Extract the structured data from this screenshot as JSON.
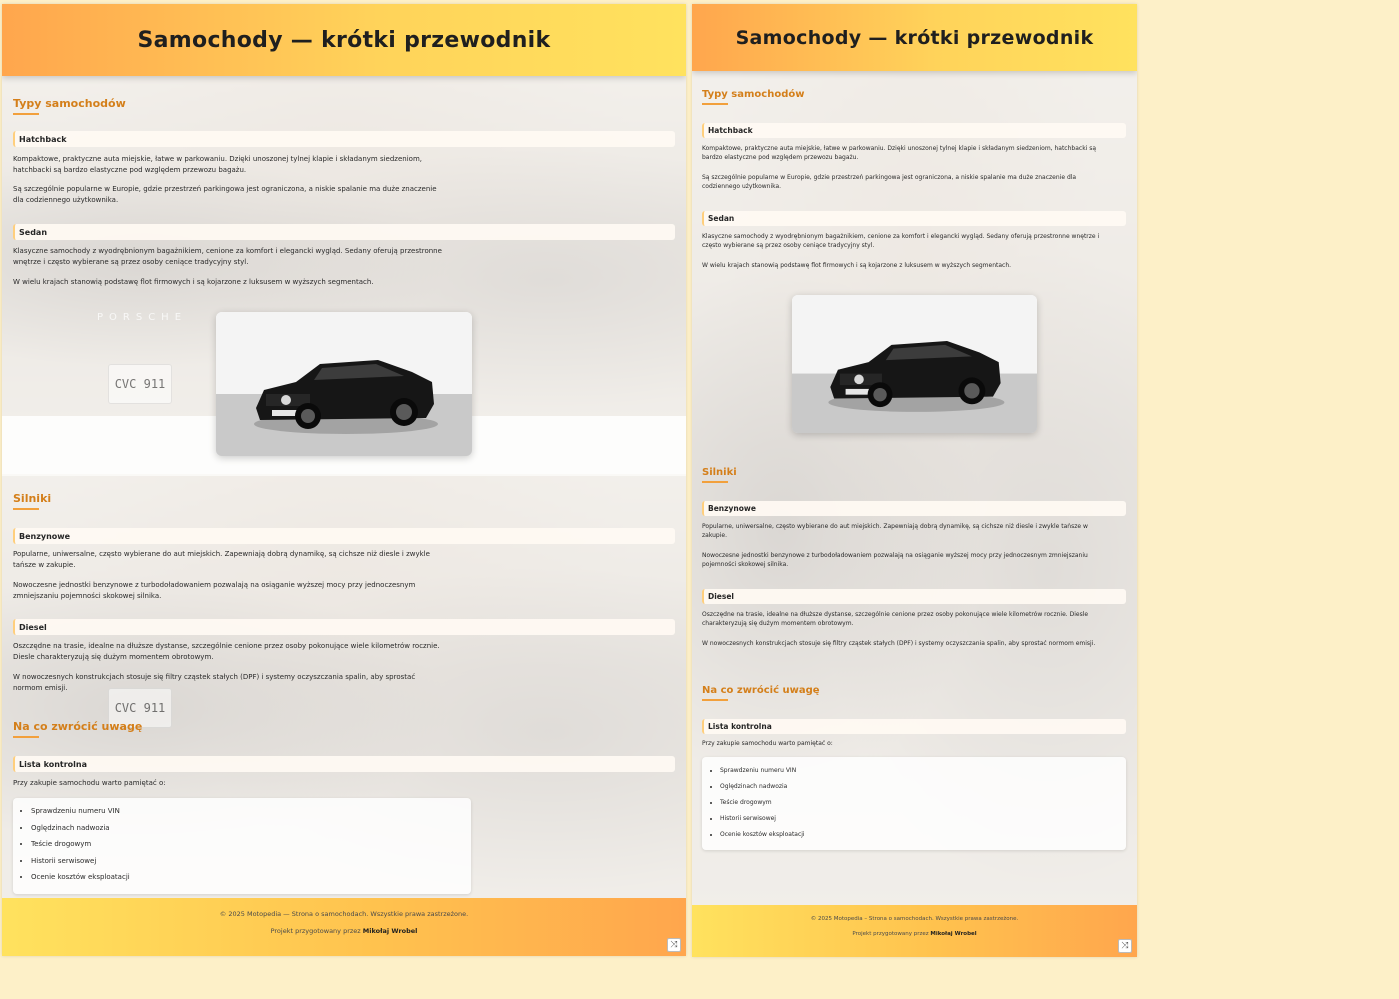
{
  "title": "Samochody — krótki przewodnik",
  "sections": {
    "types": {
      "title": "Typy samochodów",
      "hatchback": {
        "title": "Hatchback",
        "p1": "Kompaktowe, praktyczne auta miejskie, łatwe w parkowaniu. Dzięki unoszonej tylnej klapie i składanym siedzeniom, hatchbacki są bardzo elastyczne pod względem przewozu bagażu.",
        "p2": "Są szczególnie popularne w Europie, gdzie przestrzeń parkingowa jest ograniczona, a niskie spalanie ma duże znaczenie dla codziennego użytkownika."
      },
      "sedan": {
        "title": "Sedan",
        "p1": "Klasyczne samochody z wyodrębnionym bagażnikiem, cenione za komfort i elegancki wygląd. Sedany oferują przestronne wnętrze i często wybierane są przez osoby ceniące tradycyjny styl.",
        "p2": "W wielu krajach stanowią podstawę flot firmowych i są kojarzone z luksusem w wyższych segmentach."
      }
    },
    "engines": {
      "title": "Silniki",
      "petrol": {
        "title": "Benzynowe",
        "p1": "Popularne, uniwersalne, często wybierane do aut miejskich. Zapewniają dobrą dynamikę, są cichsze niż diesle i zwykle tańsze w zakupie.",
        "p2": "Nowoczesne jednostki benzynowe z turbodoładowaniem pozwalają na osiąganie wyższej mocy przy jednoczesnym zmniejszaniu pojemności skokowej silnika."
      },
      "diesel": {
        "title": "Diesel",
        "p1": "Oszczędne na trasie, idealne na dłuższe dystanse, szczególnie cenione przez osoby pokonujące wiele kilometrów rocznie. Diesle charakteryzują się dużym momentem obrotowym.",
        "p2": "W nowoczesnych konstrukcjach stosuje się filtry cząstek stałych (DPF) i systemy oczyszczania spalin, aby sprostać normom emisji."
      }
    },
    "checklist": {
      "title": "Na co zwrócić uwagę",
      "subtitle": "Lista kontrolna",
      "intro": "Przy zakupie samochodu warto pamiętać o:",
      "items": [
        "Sprawdzeniu numeru VIN",
        "Oględzinach nadwozia",
        "Teście drogowym",
        "Historii serwisowej",
        "Ocenie kosztów eksploatacji"
      ]
    }
  },
  "background": {
    "brand": "PORSCHE",
    "plate": "CVC 911"
  },
  "footer": {
    "copyright_left": "© 2025 Motopedia — Strona o samochodach. Wszystkie prawa zastrzeżone.",
    "copyright_right": "© 2025 Motopedia – Strona o samochodach. Wszystkie prawa zastrzeżone.",
    "credit_prefix": "Projekt przygotowany przez",
    "author": "Mikołaj Wrobel"
  },
  "icons": {
    "corner_button": "shuffle-icon"
  },
  "colors": {
    "accent": "#d47f1a",
    "header_start": "#ffa64d",
    "header_end": "#ffe25e",
    "page_bg": "#fdf0c8"
  }
}
